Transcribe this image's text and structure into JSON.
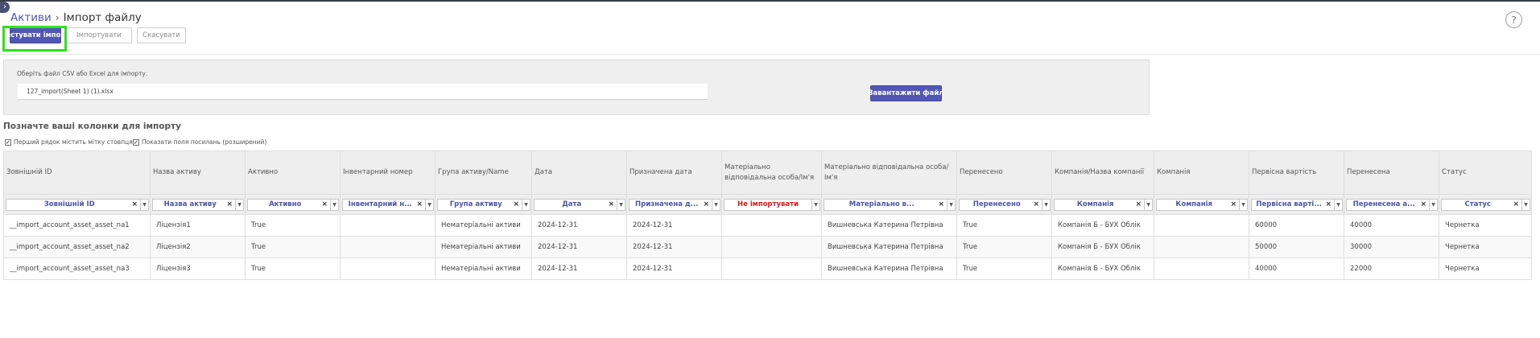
{
  "breadcrumb": {
    "parent": "Активи",
    "separator": "›",
    "current": "Імпорт файлу"
  },
  "toolbar": {
    "test_label": "Тестувати імпорт",
    "import_label": "Імпортувати",
    "cancel_label": "Скасувати",
    "help_label": "?"
  },
  "upload": {
    "hint": "Оберіть файл CSV або Excel для імпорту.",
    "file_name": "127_import(Sheet 1) (1).xlsx",
    "button_label": "Завантажити файл"
  },
  "mapping": {
    "title": "Позначте ваші колонки для імпорту",
    "option_header": "Перший рядок містить мітку стовпця",
    "option_advanced": "Показати поля посилань (розширений)"
  },
  "table": {
    "columns": [
      {
        "header": "Зовнішній ID",
        "selected": "Зовнішній ID",
        "clear": true,
        "warn": false
      },
      {
        "header": "Назва активу",
        "selected": "Назва активу",
        "clear": true,
        "warn": false
      },
      {
        "header": "Активно",
        "selected": "Активно",
        "clear": true,
        "warn": false
      },
      {
        "header": "Інвентарний номер",
        "selected": "Інвентарний н...",
        "clear": true,
        "warn": false
      },
      {
        "header": "Група активу/Name",
        "selected": "Група активу",
        "clear": true,
        "warn": false
      },
      {
        "header": "Дата",
        "selected": "Дата",
        "clear": true,
        "warn": false
      },
      {
        "header": "Призначена дата",
        "selected": "Призначена д...",
        "clear": true,
        "warn": false
      },
      {
        "header": "Матеріально відповідальна особа/Ім'я",
        "selected": "Не імпортувати",
        "clear": false,
        "warn": true
      },
      {
        "header": "Матеріально відповідальна особа/Ім'я",
        "selected": "Матеріально в...",
        "clear": true,
        "warn": false
      },
      {
        "header": "Перенесено",
        "selected": "Перенесено",
        "clear": true,
        "warn": false
      },
      {
        "header": "Компанія/Назва компанії",
        "selected": "Компанія",
        "clear": true,
        "warn": false
      },
      {
        "header": "Компанія",
        "selected": "Компанія",
        "clear": true,
        "warn": false
      },
      {
        "header": "Первісна вартість",
        "selected": "Первісна варті...",
        "clear": true,
        "warn": false
      },
      {
        "header": "Перенесена",
        "selected": "Перенесена а...",
        "clear": true,
        "warn": false
      },
      {
        "header": "Статус",
        "selected": "Статус",
        "clear": true,
        "warn": false
      }
    ],
    "rows": [
      [
        "__import_account_asset_asset_na1",
        "Ліцензія1",
        "True",
        "",
        "Нематеріальні активи",
        "2024-12-31",
        "2024-12-31",
        "",
        "Вишневська Катерина Петрівна",
        "True",
        "Компанія Б - БУХ Облік",
        "",
        "60000",
        "40000",
        "Чернетка"
      ],
      [
        "__import_account_asset_asset_na2",
        "Ліцензія2",
        "True",
        "",
        "Нематеріальні активи",
        "2024-12-31",
        "2024-12-31",
        "",
        "Вишневська Катерина Петрівна",
        "True",
        "Компанія Б - БУХ Облік",
        "",
        "50000",
        "30000",
        "Чернетка"
      ],
      [
        "__import_account_asset_asset_na3",
        "Ліцензія3",
        "True",
        "",
        "Нематеріальні активи",
        "2024-12-31",
        "2024-12-31",
        "",
        "Вишневська Катерина Петрівна",
        "True",
        "Компанія Б - БУХ Облік",
        "",
        "40000",
        "22000",
        "Чернетка"
      ]
    ]
  },
  "colors": {
    "accent": "#5156b6",
    "highlight": "#2fe21d",
    "warning": "#e21a1a"
  }
}
